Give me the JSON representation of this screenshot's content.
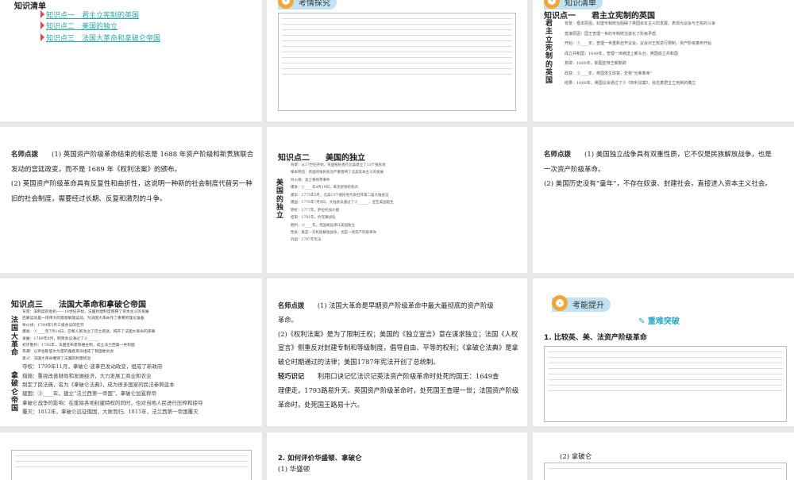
{
  "s1": {
    "title": "知识清单",
    "links": [
      "知识点一　君主立宪制的英国",
      "知识点二　美国的独立",
      "知识点三　法国大革命和拿破仑帝国"
    ]
  },
  "s2": {
    "badge": "考情探究"
  },
  "s3": {
    "badge": "知识清单",
    "heading": "知识点一　　君主立宪制的英国",
    "vertical": "君主立宪制的英国",
    "lines": [
      "背景：根本原因，封建专制统治阻碍了英国资本主义的发展，表现为议会与王权的斗争",
      "直接原因：国王查理一世的专制统治激化了阶级矛盾",
      "开始：①____年，查理一世重新召开议会，议会对王权进行限制，资产阶级革命开始",
      "成立共和国：1649年，查理一世被送上断头台，英国成立共和国",
      "复辟：1660年，斯图亚特王朝复辟",
      "政变：②____年，英国发生政变，史称“光荣革命”",
      "结果：1689年，英国议会通过了③《权利法案》，标志着君主立宪制的确立"
    ]
  },
  "s4": {
    "label": "名师点拨",
    "p1": "(1) 英国资产阶级革命结束的标志是 1688 年资产阶级和新贵族联合发动的宫廷政变，而不是 1689 年《权利法案》的颁布。",
    "p2": "(2) 英国资产阶级革命具有反复性和曲折性，这说明一种新的社会制度代替另一种旧的社会制度，需要经过长期、反复和激烈的斗争。"
  },
  "s5": {
    "heading": "知识点二　　美国的独立",
    "vertical": "美国的独立",
    "lines": [
      "背景：从17世纪开始，英国殖民者在北美建立了13个殖民地",
      "根本原因：英国的殖民统治严重阻碍了北美资本主义的发展",
      "导火线：波士顿倾茶事件",
      "爆发：①____年4月19日，来克星顿的枪声",
      "建军：1775年5月，北美13个殖民地代表召开第二届大陆会议",
      "建国：1776年7月4日，大陆会议通过了②______，宣告美国诞生",
      "转折：1777年，萨拉托加大捷",
      "结束：1781年，约克镇战役",
      "胜利：③____年，英国被迫承认美国独立",
      "性质：既是一次民族解放战争，也是一场资产阶级革命",
      "巩固：1787年宪法"
    ]
  },
  "s6": {
    "label": "名师点拨",
    "p1": "(1) 美国独立战争具有双重性质，它不仅是民族解放战争，也是",
    "p1b": "一次资产阶级革命。",
    "p2": "(2) 美国历史没有“童年”，不存在奴隶、封建社会，直接进入资本主义社会。"
  },
  "s7": {
    "heading": "知识点三　　法国大革命和拿破仑帝国",
    "v1": "法国大革命",
    "v2": "拿破仑帝国",
    "lines": [
      "背景：旧制度的危机——18世纪开始，法国封建制度阻碍了资本主义的发展",
      "启蒙运动是一场伟大的思想解放运动，为法国大革命作了重要的理论准备",
      "导火线：1789年5月三级会议的召开",
      "爆发：①____年7月14日，巴黎人民攻占了巴士底狱，揭开了法国大革命的序幕",
      "发展：1789年8月，制宪会议通过了②______",
      "初步胜利：1792年，法国宣布废除君主制，成立法兰西第一共和国",
      "高潮：以罗伯斯庇尔为首的雅各宾派组成了救国委员会",
      "意义：法国大革命摧毁了法国的封建统治",
      "夺权：1799年11月，拿破仑·波拿巴发动政变，组成了新政府",
      "措施：重视改善财政和发展经济，大力发展工商业和农业",
      "制定了民法典，名为《拿破仑法典》，成为很多国家的民法参照蓝本",
      "建国：③____年，建立“法兰西第一帝国”，拿破仑加冕称帝",
      "拿破仑战争的影响：在废除各地封建特权的同时，也对当地人民进行压榨和掠夺",
      "覆灭：1812年，拿破仑远征俄国，大败而归。1815年，法兰西第一帝国覆灭"
    ]
  },
  "s8": {
    "label": "名师点拨",
    "p1": "(1) 法国大革命是早期资产阶级革命中最大最彻底的资产阶级",
    "p1b": "革命。",
    "p2": "(2)《权利法案》是为了限制王权；美国的《独立宣言》意在谋求独立；法国《人权宣言》侧重反对封建专制和等级制度，倡导自由、平等的权利；《拿破仑法典》是拿破仑时期通过的法律；美国1787年宪法开创了总统制。",
    "label2": "轻巧识记",
    "p3": "利用口诀记忆法识记英法资产阶级革命时处死的国王：1649查",
    "p3b": "理便走，1793路易升天。英国资产阶级革命时，处死国王查理一世；法国资产阶级革命时，处死国王路易十六。"
  },
  "s9": {
    "badge": "考能提升",
    "sub": "重难突破",
    "heading": "1. 比较英、美、法资产阶级革命"
  },
  "s11": {
    "heading": "2. 如何评价华盛顿、拿破仑",
    "sub": "(1) 华盛顿"
  },
  "s12": {
    "sub": "(2) 拿破仑"
  }
}
